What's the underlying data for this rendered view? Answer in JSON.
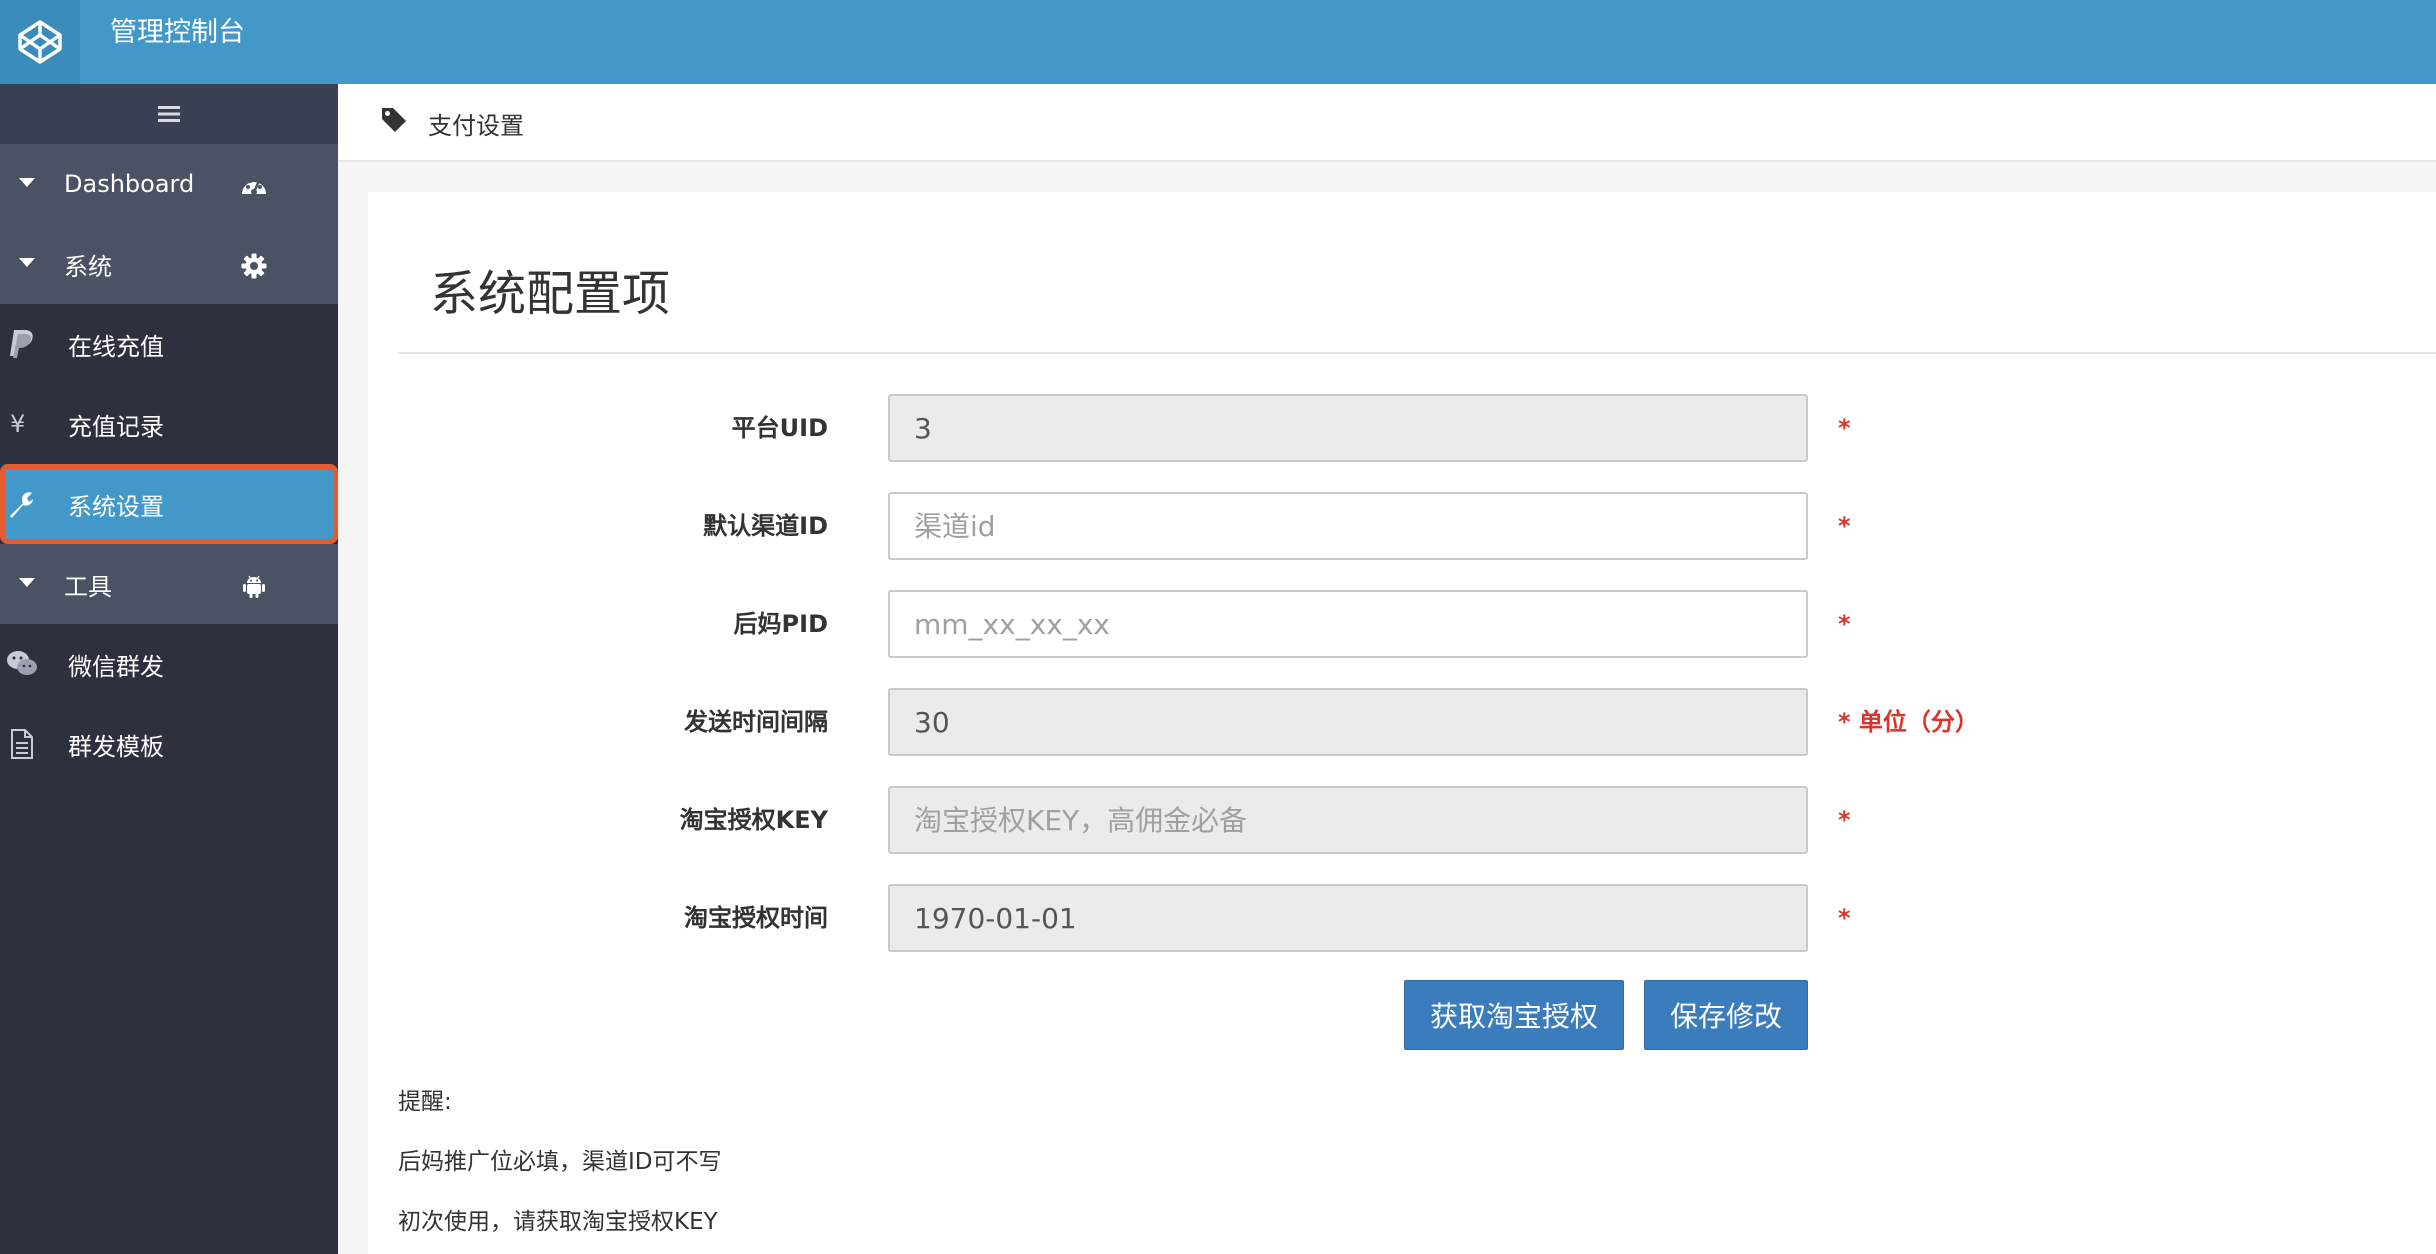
{
  "header": {
    "title": "管理控制台"
  },
  "sidebar": {
    "toggle_icon": "hamburger-icon",
    "groups": [
      {
        "label": "Dashboard",
        "icon": "dashboard-icon"
      },
      {
        "label": "系统",
        "icon": "gear-icon"
      },
      {
        "label": "工具",
        "icon": "android-icon"
      }
    ],
    "items": [
      {
        "label": "在线充值",
        "icon": "paypal-icon"
      },
      {
        "label": "充值记录",
        "icon": "yen-icon"
      },
      {
        "label": "系统设置",
        "icon": "wrench-icon",
        "active": true
      },
      {
        "label": "微信群发",
        "icon": "wechat-icon"
      },
      {
        "label": "群发模板",
        "icon": "document-icon"
      }
    ]
  },
  "breadcrumb": {
    "label": "支付设置",
    "icon": "tag-icon"
  },
  "card": {
    "title": "系统配置项"
  },
  "form": {
    "fields": [
      {
        "label": "平台UID",
        "value": "3",
        "placeholder": "",
        "readonly": true,
        "required_note": "*"
      },
      {
        "label": "默认渠道ID",
        "value": "",
        "placeholder": "渠道id",
        "readonly": false,
        "required_note": "*"
      },
      {
        "label": "后妈PID",
        "value": "",
        "placeholder": "mm_xx_xx_xx",
        "readonly": false,
        "required_note": "*"
      },
      {
        "label": "发送时间间隔",
        "value": "30",
        "placeholder": "",
        "readonly": true,
        "required_note": "* 单位（分）"
      },
      {
        "label": "淘宝授权KEY",
        "value": "",
        "placeholder": "淘宝授权KEY，高佣金必备",
        "readonly": true,
        "required_note": "*"
      },
      {
        "label": "淘宝授权时间",
        "value": "1970-01-01",
        "placeholder": "",
        "readonly": true,
        "required_note": "*"
      }
    ],
    "buttons": {
      "get_auth": "获取淘宝授权",
      "save": "保存修改"
    }
  },
  "tips": {
    "heading": "提醒:",
    "lines": [
      "后妈推广位必填，渠道ID可不写",
      "初次使用，请获取淘宝授权KEY"
    ]
  },
  "colors": {
    "header_bg": "#4299c9",
    "sidebar_bg": "#2c313d",
    "sidebar_group_bg": "#4b5264",
    "active_item_bg": "#4299c9",
    "active_outline": "#e55b2f",
    "button_bg": "#3b7cbd",
    "required_red": "#d9352a"
  }
}
